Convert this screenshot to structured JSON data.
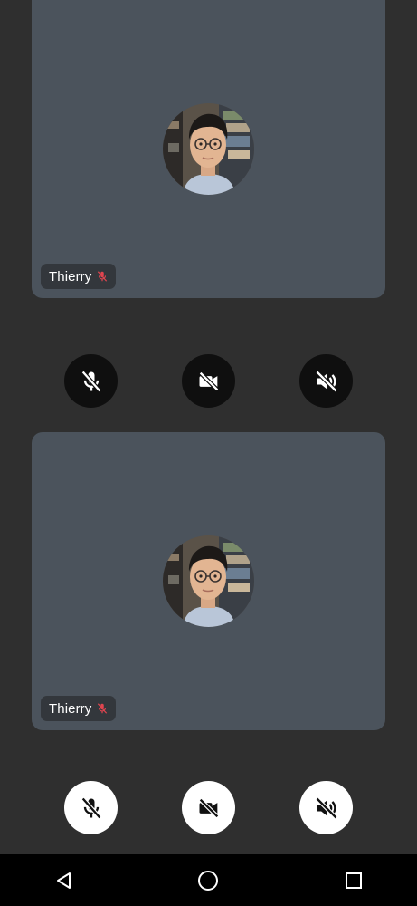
{
  "participants": [
    {
      "name": "Thierry",
      "muted": true,
      "avatar_icon": "profile-photo-icon"
    },
    {
      "name": "Thierry",
      "muted": true,
      "avatar_icon": "profile-photo-icon"
    }
  ],
  "controls_dark": {
    "mic": "mic-off-icon",
    "camera": "videocam-off-icon",
    "speaker": "volume-off-icon"
  },
  "controls_light": {
    "mic": "mic-off-icon",
    "camera": "videocam-off-icon",
    "speaker": "volume-off-icon"
  },
  "navbar": {
    "back": "back-triangle-icon",
    "home": "home-circle-icon",
    "recents": "recents-square-icon"
  },
  "colors": {
    "background": "#2f2f2f",
    "tile": "#4b535c",
    "chip": "#33373c",
    "muted_red": "#e0454f",
    "dark_button": "#0f0f0f",
    "light_button": "#ffffff",
    "navbar": "#000000"
  }
}
